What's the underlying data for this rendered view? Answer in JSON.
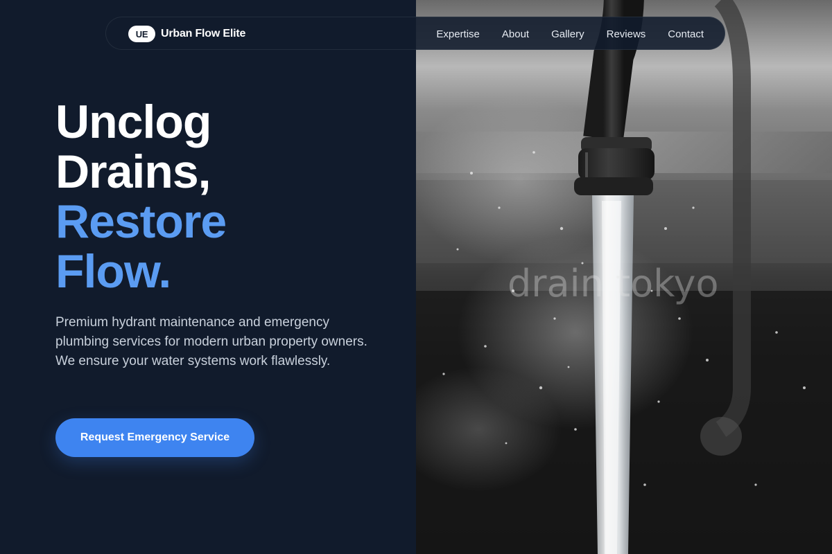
{
  "brand": {
    "badge": "UE",
    "name": "Urban Flow Elite"
  },
  "nav": {
    "links": [
      "Expertise",
      "About",
      "Gallery",
      "Reviews",
      "Contact"
    ]
  },
  "hero": {
    "title_line1": "Unclog",
    "title_line2": "Drains,",
    "title_line3": "Restore",
    "title_line4": "Flow.",
    "description": "Premium hydrant maintenance and emergency plumbing services for modern urban property owners. We ensure your water systems work flawlessly.",
    "cta_label": "Request Emergency Service"
  },
  "image": {
    "watermark": "drain tokyo"
  },
  "colors": {
    "background": "#111b2c",
    "accent": "#5b9cf2",
    "button": "#3e84f0"
  },
  "icons": {
    "hero_image": "running-faucet-photo"
  }
}
